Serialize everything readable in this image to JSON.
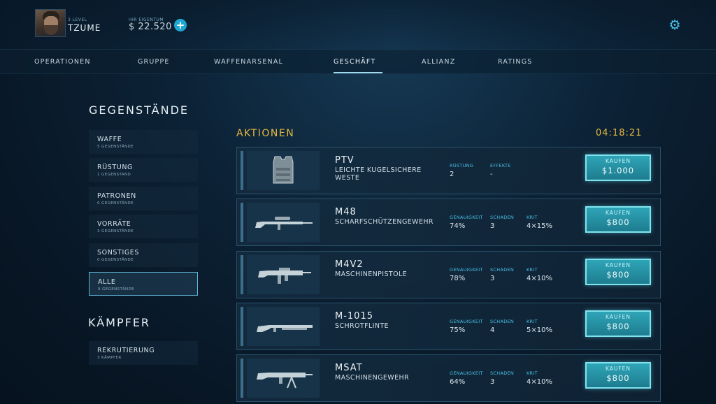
{
  "header": {
    "level_label": "3 LEVEL",
    "player_name": "TZUME",
    "balance_caption": "IHR EIGENTUM",
    "balance": "$ 22.520"
  },
  "nav": {
    "tabs": [
      "OPERATIONEN",
      "GRUPPE",
      "WAFFENARSENAL",
      "GESCHÄFT",
      "ALLIANZ",
      "RATINGS"
    ],
    "active": "GESCHÄFT"
  },
  "sidebar": {
    "items_title": "GEGENSTÄNDE",
    "categories": [
      {
        "label": "WAFFE",
        "sub": "5 GEGENSTÄNDE"
      },
      {
        "label": "RÜSTUNG",
        "sub": "1 GEGENSTAND"
      },
      {
        "label": "PATRONEN",
        "sub": "0 GEGENSTÄNDE"
      },
      {
        "label": "VORRÄTE",
        "sub": "3 GEGENSTÄNDE"
      },
      {
        "label": "SONSTIGES",
        "sub": "0 GEGENSTÄNDE"
      },
      {
        "label": "ALLE",
        "sub": "9 GEGENSTÄNDE"
      }
    ],
    "active_category": "ALLE",
    "fighters_title": "KÄMPFER",
    "fighters": [
      {
        "label": "REKRUTIERUNG",
        "sub": "3 KÄMPFER"
      }
    ]
  },
  "main": {
    "section_title": "AKTIONEN",
    "timer": "04:18:21",
    "buy_label": "KAUFEN",
    "items": [
      {
        "name": "PTV",
        "desc": "LEICHTE KUGELSICHERE WESTE",
        "icon": "vest-icon",
        "stats": [
          {
            "label": "RÜSTUNG",
            "value": "2"
          },
          {
            "label": "EFFEKTE",
            "value": "-"
          }
        ],
        "price": "$1.000"
      },
      {
        "name": "M48",
        "desc": "SCHARFSCHÜTZENGEWEHR",
        "icon": "sniper-rifle-icon",
        "stats": [
          {
            "label": "GENAUIGKEIT",
            "value": "74%"
          },
          {
            "label": "SCHADEN",
            "value": "3"
          },
          {
            "label": "KRIT",
            "value": "4×15%"
          }
        ],
        "price": "$800"
      },
      {
        "name": "M4V2",
        "desc": "MASCHINENPISTOLE",
        "icon": "smg-icon",
        "stats": [
          {
            "label": "GENAUIGKEIT",
            "value": "78%"
          },
          {
            "label": "SCHADEN",
            "value": "3"
          },
          {
            "label": "KRIT",
            "value": "4×10%"
          }
        ],
        "price": "$800"
      },
      {
        "name": "M-1015",
        "desc": "SCHROTFLINTE",
        "icon": "shotgun-icon",
        "stats": [
          {
            "label": "GENAUIGKEIT",
            "value": "75%"
          },
          {
            "label": "SCHADEN",
            "value": "4"
          },
          {
            "label": "KRIT",
            "value": "5×10%"
          }
        ],
        "price": "$800"
      },
      {
        "name": "MSAT",
        "desc": "MASCHINENGEWEHR",
        "icon": "machine-gun-icon",
        "stats": [
          {
            "label": "GENAUIGKEIT",
            "value": "64%"
          },
          {
            "label": "SCHADEN",
            "value": "3"
          },
          {
            "label": "KRIT",
            "value": "4×10%"
          }
        ],
        "price": "$800"
      }
    ]
  },
  "colors": {
    "accent": "#49c3e8",
    "gold": "#e8b93e",
    "buy_button": "#1e7c8f"
  }
}
